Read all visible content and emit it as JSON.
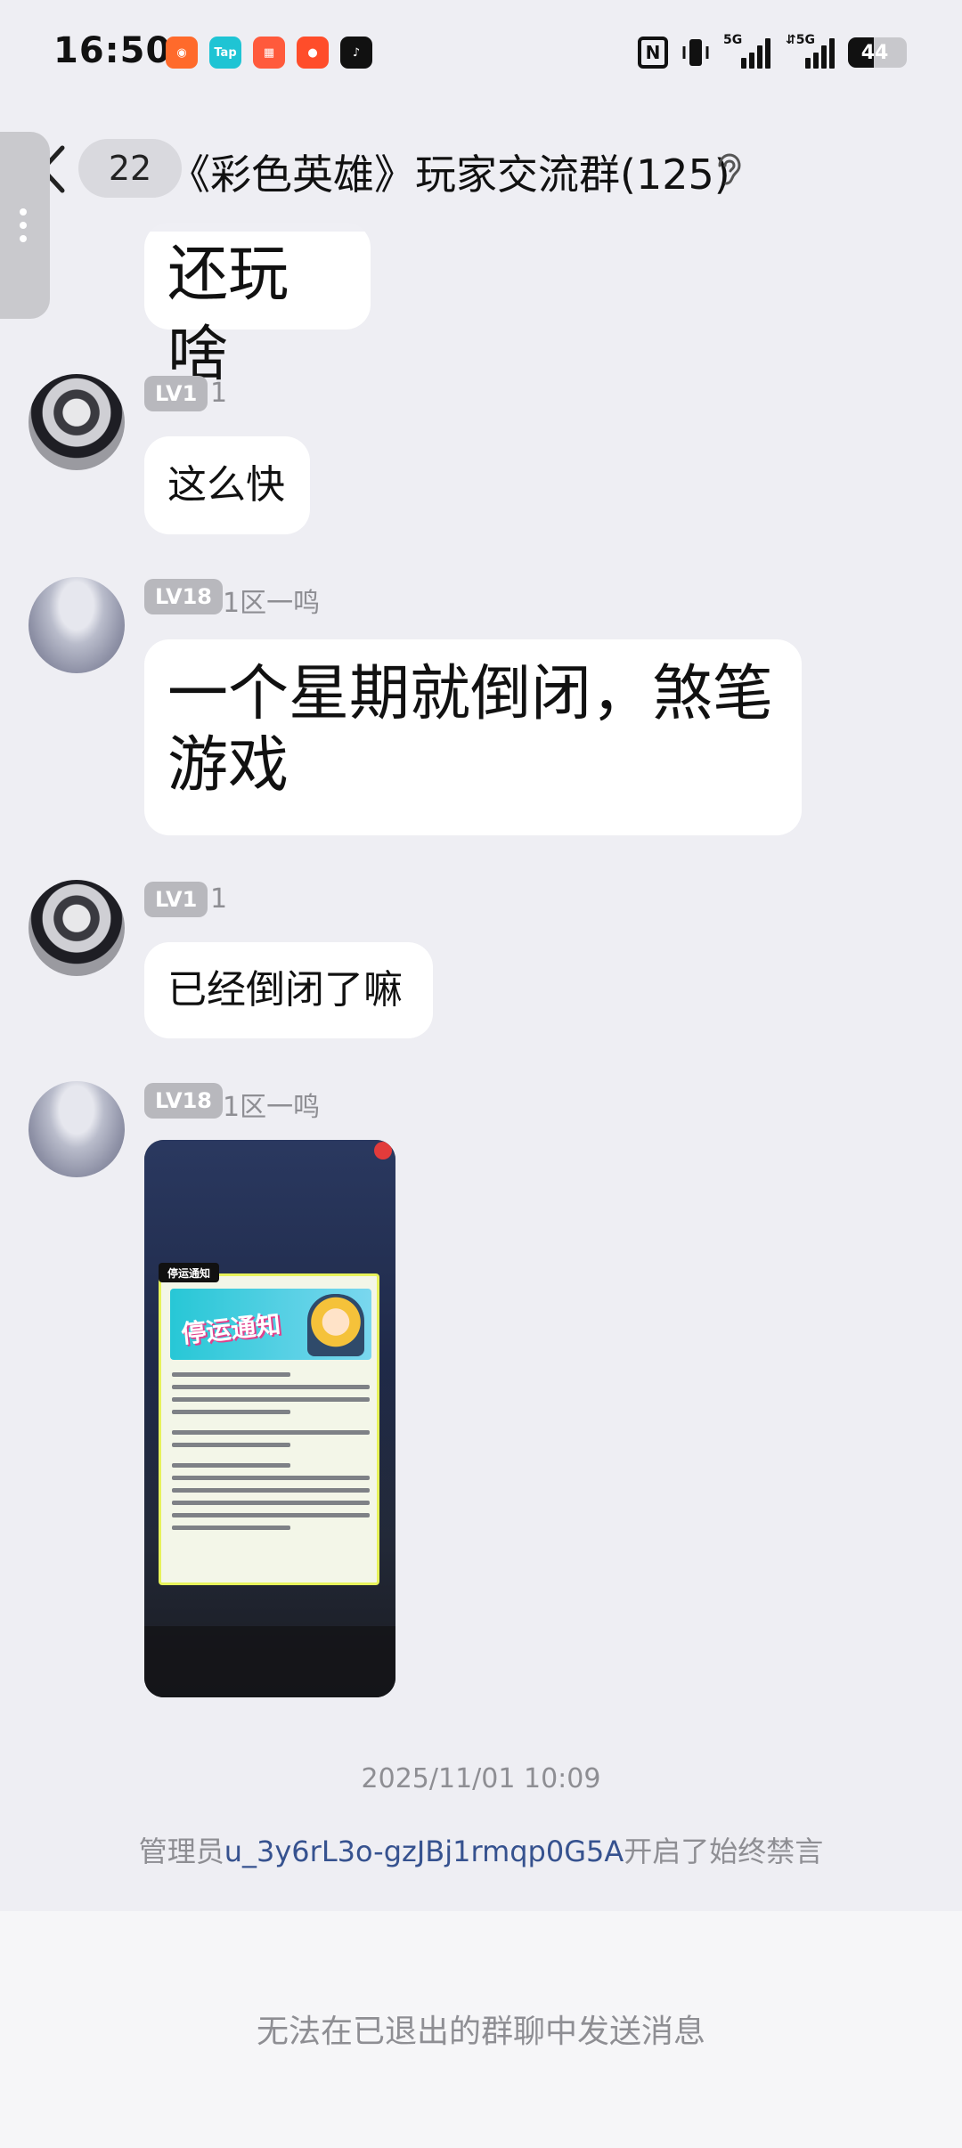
{
  "status_bar": {
    "time": "16:50",
    "app_icons": [
      {
        "name": "app-icon-1",
        "color": "#ff6a2b",
        "text": "◉"
      },
      {
        "name": "taptap-icon",
        "color": "#1fc4d4",
        "text": "Tap"
      },
      {
        "name": "app-icon-3",
        "color": "#ff5a3c",
        "text": "▦"
      },
      {
        "name": "app-icon-4",
        "color": "#ff4d2a",
        "text": "●"
      },
      {
        "name": "tiktok-icon",
        "color": "#111111",
        "text": "♪"
      }
    ],
    "battery_level": "44"
  },
  "header": {
    "unread_count": "22",
    "title": "《彩色英雄》玩家交流群(125)"
  },
  "messages": {
    "m1": {
      "text": "还玩啥"
    },
    "m2": {
      "level": "LV1",
      "nick": "1",
      "text": "这么快"
    },
    "m3": {
      "level": "LV18",
      "nick": "1区一鸣",
      "text": "一个星期就倒闭，煞笔游戏"
    },
    "m4": {
      "level": "LV1",
      "nick": "1",
      "text": "已经倒闭了嘛"
    },
    "m5": {
      "level": "LV18",
      "nick": "1区一鸣",
      "image_notice_tag": "停运通知",
      "image_banner_title": "停运通知"
    }
  },
  "timestamp": "2025/11/01 10:09",
  "system_note": {
    "prefix": "管理员",
    "user": "u_3y6rL3o-gzJBj1rmqp0G5A",
    "suffix": "开启了始终禁言"
  },
  "footer": {
    "text": "无法在已退出的群聊中发送消息"
  },
  "colors": {
    "background": "#eeeef3",
    "bubble": "#ffffff",
    "level_badge": "#b8b8bd",
    "link": "#36528f"
  }
}
